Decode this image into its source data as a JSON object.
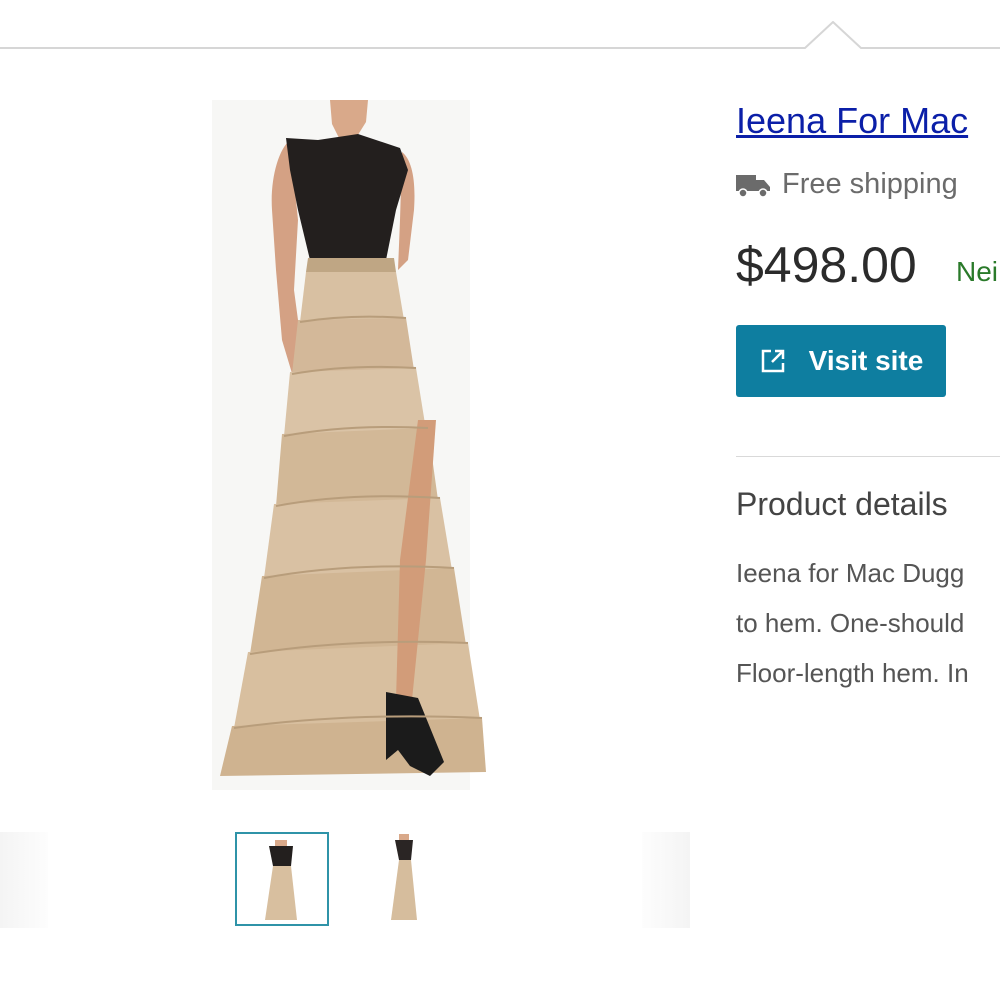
{
  "product": {
    "title": "Ieena For Mac",
    "shipping": "Free shipping",
    "price": "$498.00",
    "seller": "Nei",
    "visit_label": "Visit site"
  },
  "details": {
    "heading": "Product details",
    "lines": [
      "Ieena for Mac Dugg",
      "to hem. One-should",
      "Floor-length hem. In"
    ]
  },
  "icons": {
    "truck": "truck-icon",
    "external_link": "external-link-icon"
  },
  "colors": {
    "title_link": "#0b1fa8",
    "visit_button": "#0e7ea0",
    "seller_green": "#2a7a2a",
    "thumb_selected_border": "#2f93a8",
    "dress_top": "#231f1e",
    "dress_skirt": "#d9bf9e"
  },
  "thumbnails": {
    "count": 2,
    "selected_index": 0
  }
}
